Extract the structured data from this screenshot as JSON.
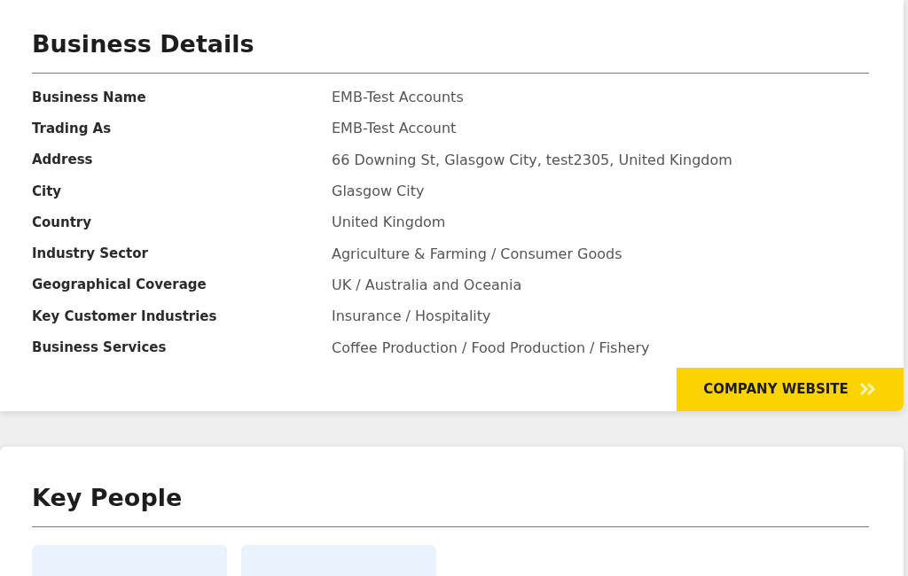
{
  "business_details": {
    "title": "Business Details",
    "rows": [
      {
        "label": "Business Name",
        "value": "EMB-Test Accounts"
      },
      {
        "label": "Trading As",
        "value": "EMB-Test Account"
      },
      {
        "label": "Address",
        "value": "66 Downing St, Glasgow City, test2305, United Kingdom"
      },
      {
        "label": "City",
        "value": "Glasgow City"
      },
      {
        "label": "Country",
        "value": "United Kingdom"
      },
      {
        "label": "Industry Sector",
        "value": "Agriculture & Farming / Consumer Goods"
      },
      {
        "label": "Geographical Coverage",
        "value": "UK / Australia and Oceania"
      },
      {
        "label": "Key Customer Industries",
        "value": "Insurance / Hospitality"
      },
      {
        "label": "Business Services",
        "value": "Coffee Production / Food Production / Fishery"
      }
    ],
    "button": "COMPANY WEBSITE"
  },
  "key_people": {
    "title": "Key People",
    "cards": [
      {
        "kind": "person"
      },
      {
        "kind": "person"
      }
    ]
  }
}
